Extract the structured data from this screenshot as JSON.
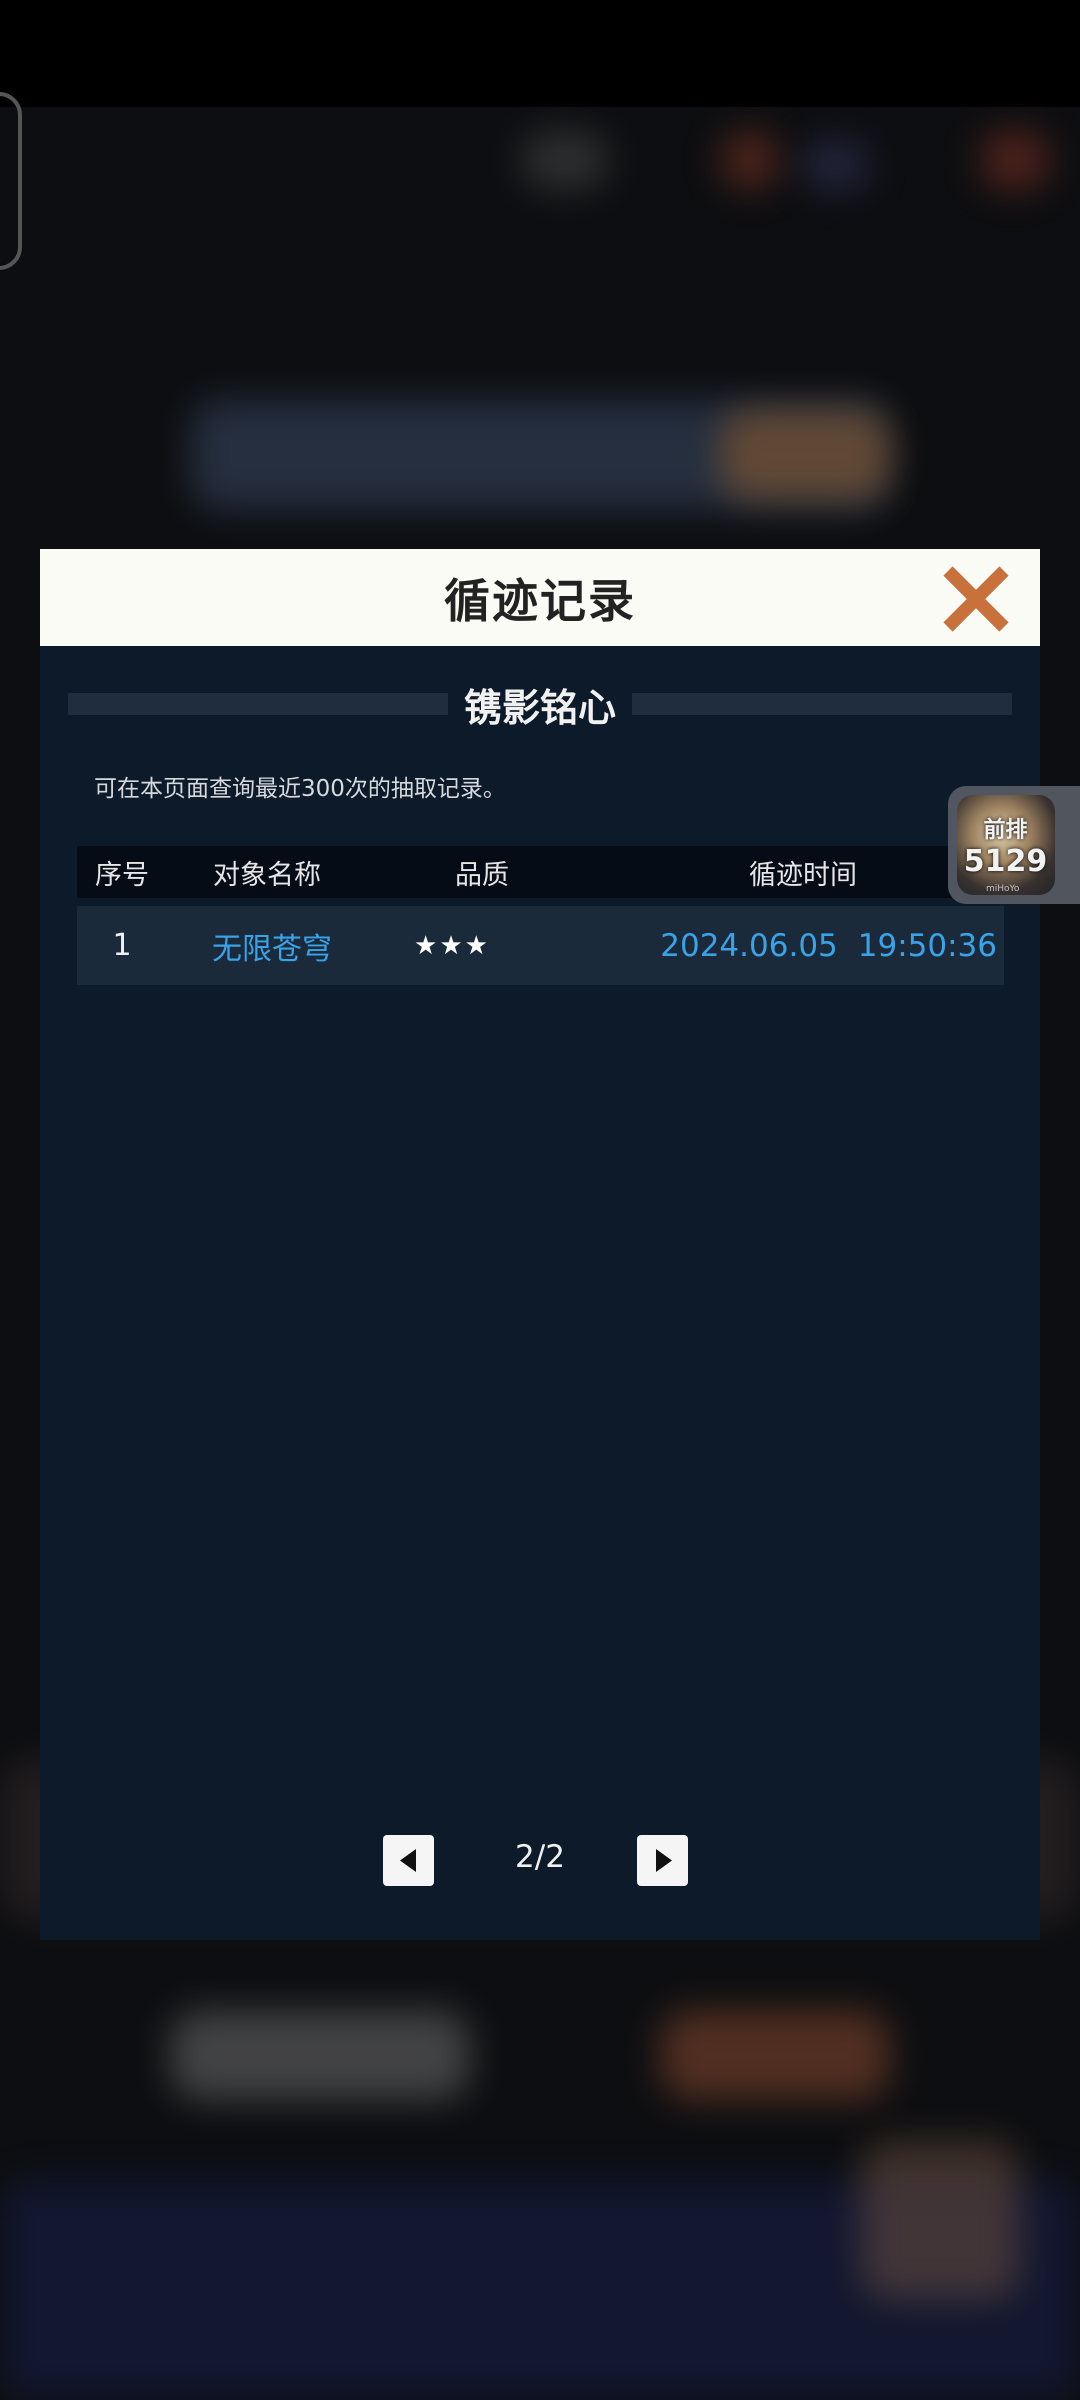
{
  "dialog": {
    "title": "循迹记录",
    "banner_title": "镌影铭心",
    "note": "可在本页面查询最近300次的抽取记录。",
    "columns": [
      "序号",
      "对象名称",
      "品质",
      "循迹时间"
    ],
    "rows": [
      {
        "index": "1",
        "name": "无限苍穹",
        "quality": "★★★",
        "date": "2024.06.05",
        "time": "19:50:36"
      }
    ],
    "pager": {
      "page": "2/2"
    }
  },
  "widget": {
    "label": "前排",
    "number": "5129",
    "brand": "miHoYo"
  },
  "colors": {
    "panel": "#0d1a29",
    "header": "#fbfbf6",
    "accent_blue": "#3aa3e8",
    "close_orange": "#c8713a"
  },
  "icons": {
    "close": "close-x-icon",
    "prev": "triangle-left-icon",
    "next": "triangle-right-icon"
  }
}
